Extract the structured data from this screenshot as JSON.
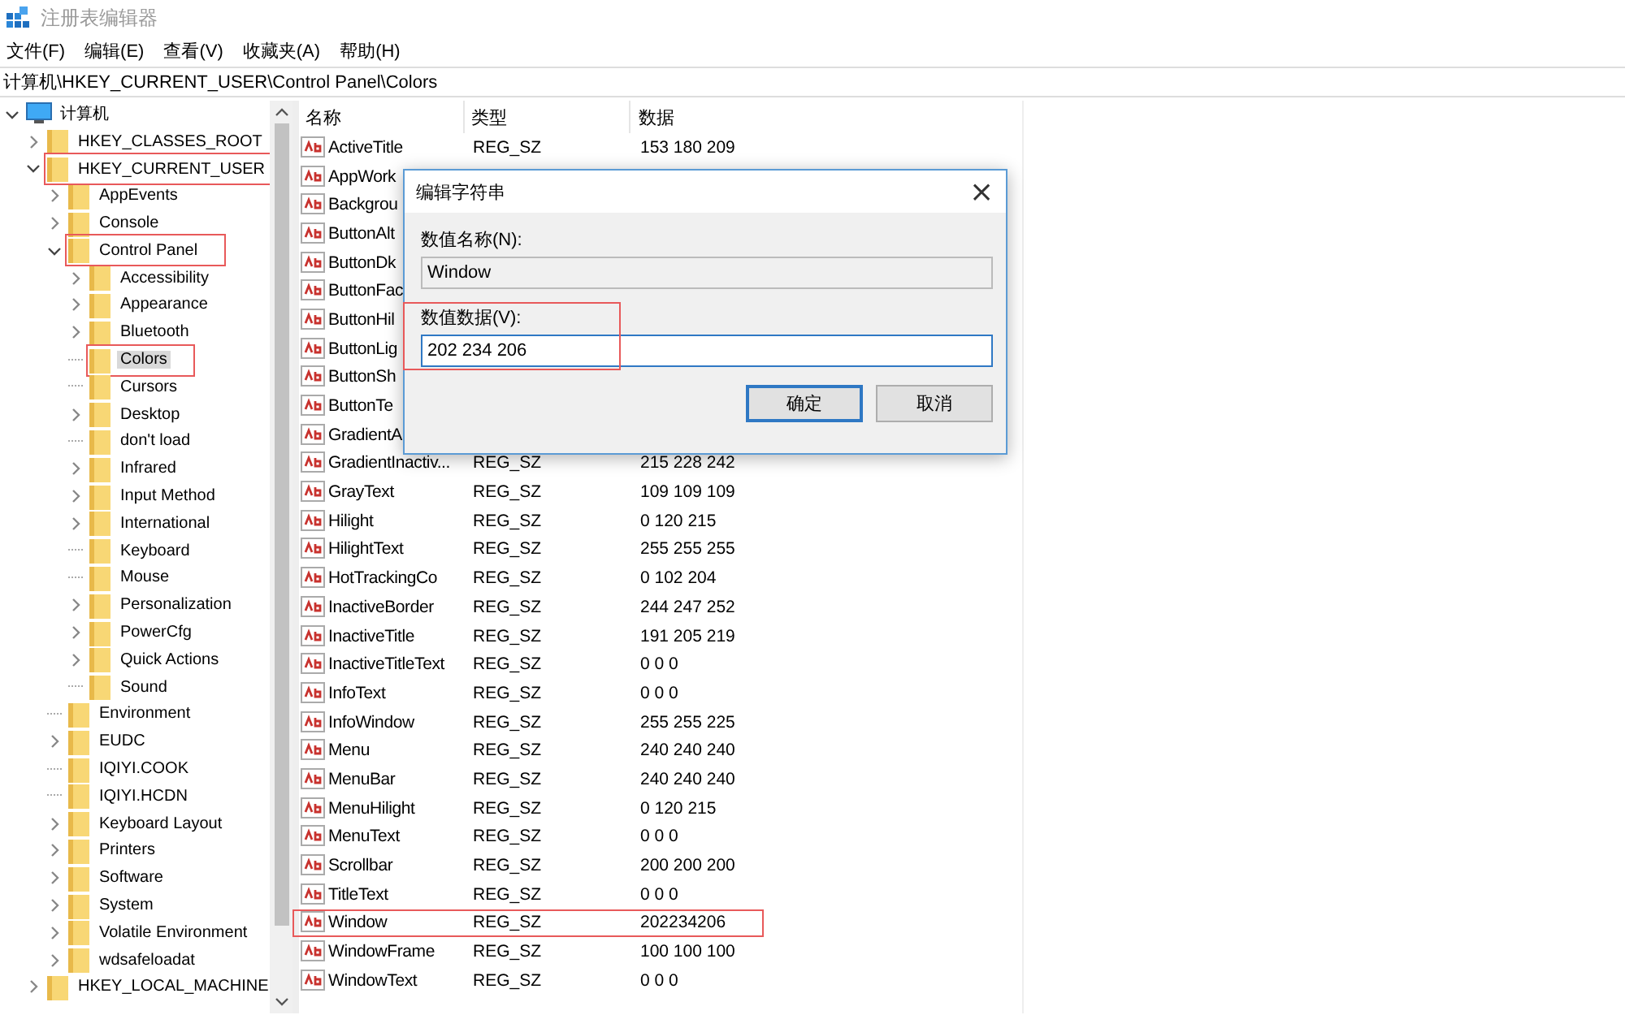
{
  "window": {
    "title": "注册表编辑器"
  },
  "menu": [
    "文件(F)",
    "编辑(E)",
    "查看(V)",
    "收藏夹(A)",
    "帮助(H)"
  ],
  "address": "计算机\\HKEY_CURRENT_USER\\Control Panel\\Colors",
  "tree": [
    {
      "label": "计算机",
      "kind": "computer",
      "expanded": true,
      "selected": false,
      "annotated": false,
      "children": [
        {
          "label": "HKEY_CLASSES_ROOT",
          "expanded": false,
          "selected": false,
          "annotated": false
        },
        {
          "label": "HKEY_CURRENT_USER",
          "expanded": true,
          "selected": false,
          "annotated": true,
          "children": [
            {
              "label": "AppEvents",
              "expanded": false,
              "selected": false,
              "annotated": false
            },
            {
              "label": "Console",
              "expanded": false,
              "selected": false,
              "annotated": false
            },
            {
              "label": "Control Panel",
              "expanded": true,
              "selected": false,
              "annotated": true,
              "children": [
                {
                  "label": "Accessibility",
                  "expanded": false,
                  "selected": false,
                  "annotated": false
                },
                {
                  "label": "Appearance",
                  "expanded": false,
                  "selected": false,
                  "annotated": false
                },
                {
                  "label": "Bluetooth",
                  "expanded": false,
                  "selected": false,
                  "annotated": false
                },
                {
                  "label": "Colors",
                  "selected": true,
                  "annotated": true
                },
                {
                  "label": "Cursors",
                  "selected": false,
                  "annotated": false
                },
                {
                  "label": "Desktop",
                  "expanded": false,
                  "selected": false,
                  "annotated": false
                },
                {
                  "label": "don't load",
                  "selected": false,
                  "annotated": false
                },
                {
                  "label": "Infrared",
                  "expanded": false,
                  "selected": false,
                  "annotated": false
                },
                {
                  "label": "Input Method",
                  "expanded": false,
                  "selected": false,
                  "annotated": false
                },
                {
                  "label": "International",
                  "expanded": false,
                  "selected": false,
                  "annotated": false
                },
                {
                  "label": "Keyboard",
                  "selected": false,
                  "annotated": false
                },
                {
                  "label": "Mouse",
                  "selected": false,
                  "annotated": false
                },
                {
                  "label": "Personalization",
                  "expanded": false,
                  "selected": false,
                  "annotated": false
                },
                {
                  "label": "PowerCfg",
                  "expanded": false,
                  "selected": false,
                  "annotated": false
                },
                {
                  "label": "Quick Actions",
                  "expanded": false,
                  "selected": false,
                  "annotated": false
                },
                {
                  "label": "Sound",
                  "selected": false,
                  "annotated": false
                }
              ]
            },
            {
              "label": "Environment",
              "selected": false,
              "annotated": false
            },
            {
              "label": "EUDC",
              "expanded": false,
              "selected": false,
              "annotated": false
            },
            {
              "label": "IQIYI.COOK",
              "selected": false,
              "annotated": false
            },
            {
              "label": "IQIYI.HCDN",
              "selected": false,
              "annotated": false
            },
            {
              "label": "Keyboard Layout",
              "expanded": false,
              "selected": false,
              "annotated": false
            },
            {
              "label": "Printers",
              "expanded": false,
              "selected": false,
              "annotated": false
            },
            {
              "label": "Software",
              "expanded": false,
              "selected": false,
              "annotated": false
            },
            {
              "label": "System",
              "expanded": false,
              "selected": false,
              "annotated": false
            },
            {
              "label": "Volatile Environment",
              "expanded": false,
              "selected": false,
              "annotated": false
            },
            {
              "label": "wdsafeloadat",
              "expanded": false,
              "selected": false,
              "annotated": false
            }
          ]
        },
        {
          "label": "HKEY_LOCAL_MACHINE",
          "expanded": false,
          "selected": false,
          "annotated": false
        }
      ]
    }
  ],
  "table": {
    "columns": [
      "名称",
      "类型",
      "数据"
    ],
    "rows": [
      {
        "name": "ActiveTitle",
        "type": "REG_SZ",
        "data": "153 180 209",
        "annotated": false
      },
      {
        "name": "AppWork",
        "annotated": false
      },
      {
        "name": "Backgrou",
        "annotated": false
      },
      {
        "name": "ButtonAlt",
        "annotated": false
      },
      {
        "name": "ButtonDk",
        "annotated": false
      },
      {
        "name": "ButtonFac",
        "annotated": false
      },
      {
        "name": "ButtonHil",
        "annotated": false
      },
      {
        "name": "ButtonLig",
        "annotated": false
      },
      {
        "name": "ButtonSh",
        "annotated": false
      },
      {
        "name": "ButtonTe",
        "annotated": false
      },
      {
        "name": "GradientA",
        "annotated": false
      },
      {
        "name": "GradientInactiv...",
        "type": "REG_SZ",
        "data": "215 228 242",
        "annotated": false
      },
      {
        "name": "GrayText",
        "type": "REG_SZ",
        "data": "109 109 109",
        "annotated": false
      },
      {
        "name": "Hilight",
        "type": "REG_SZ",
        "data": "0 120 215",
        "annotated": false
      },
      {
        "name": "HilightText",
        "type": "REG_SZ",
        "data": "255 255 255",
        "annotated": false
      },
      {
        "name": "HotTrackingCo",
        "type": "REG_SZ",
        "data": "0 102 204",
        "annotated": false
      },
      {
        "name": "InactiveBorder",
        "type": "REG_SZ",
        "data": "244 247 252",
        "annotated": false
      },
      {
        "name": "InactiveTitle",
        "type": "REG_SZ",
        "data": "191 205 219",
        "annotated": false
      },
      {
        "name": "InactiveTitleText",
        "type": "REG_SZ",
        "data": "0 0 0",
        "annotated": false
      },
      {
        "name": "InfoText",
        "type": "REG_SZ",
        "data": "0 0 0",
        "annotated": false
      },
      {
        "name": "InfoWindow",
        "type": "REG_SZ",
        "data": "255 255 225",
        "annotated": false
      },
      {
        "name": "Menu",
        "type": "REG_SZ",
        "data": "240 240 240",
        "annotated": false
      },
      {
        "name": "MenuBar",
        "type": "REG_SZ",
        "data": "240 240 240",
        "annotated": false
      },
      {
        "name": "MenuHilight",
        "type": "REG_SZ",
        "data": "0 120 215",
        "annotated": false
      },
      {
        "name": "MenuText",
        "type": "REG_SZ",
        "data": "0 0 0",
        "annotated": false
      },
      {
        "name": "Scrollbar",
        "type": "REG_SZ",
        "data": "200 200 200",
        "annotated": false
      },
      {
        "name": "TitleText",
        "type": "REG_SZ",
        "data": "0 0 0",
        "annotated": false
      },
      {
        "name": "Window",
        "type": "REG_SZ",
        "data": "202234206",
        "annotated": true
      },
      {
        "name": "WindowFrame",
        "type": "REG_SZ",
        "data": "100 100 100",
        "annotated": false
      },
      {
        "name": "WindowText",
        "type": "REG_SZ",
        "data": "0 0 0",
        "annotated": false
      }
    ]
  },
  "dialog": {
    "title": "编辑字符串",
    "close": "×",
    "name_label": "数值名称(N):",
    "name_value": "Window",
    "data_label": "数值数据(V):",
    "data_value": "202 234 206",
    "data_annotated": true,
    "buttons": [
      {
        "label": "确定",
        "default": true
      },
      {
        "label": "取消",
        "default": false
      }
    ]
  }
}
